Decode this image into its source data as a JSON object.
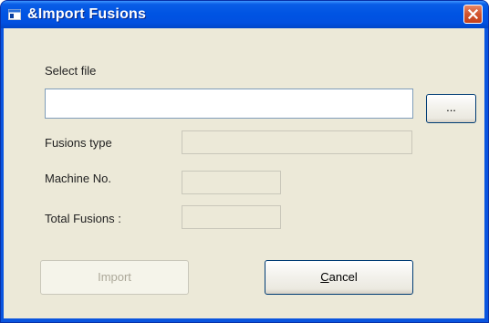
{
  "window": {
    "title": "&Import Fusions",
    "title_icon": "window-icon",
    "close_icon": "close-icon"
  },
  "form": {
    "select_file_label": "Select file",
    "file_path_value": "",
    "browse_button_label": "...",
    "fusions_type_label": "Fusions type",
    "fusions_type_value": "",
    "machine_no_label": "Machine No.",
    "machine_no_value": "",
    "total_fusions_label": "Total Fusions :",
    "total_fusions_value": ""
  },
  "buttons": {
    "import_label": "Import",
    "cancel_label_accel": "C",
    "cancel_label_rest": "ancel"
  },
  "colors": {
    "titlebar": "#0054e3",
    "client_background": "#ece9d8",
    "close_button": "#d2542e"
  }
}
